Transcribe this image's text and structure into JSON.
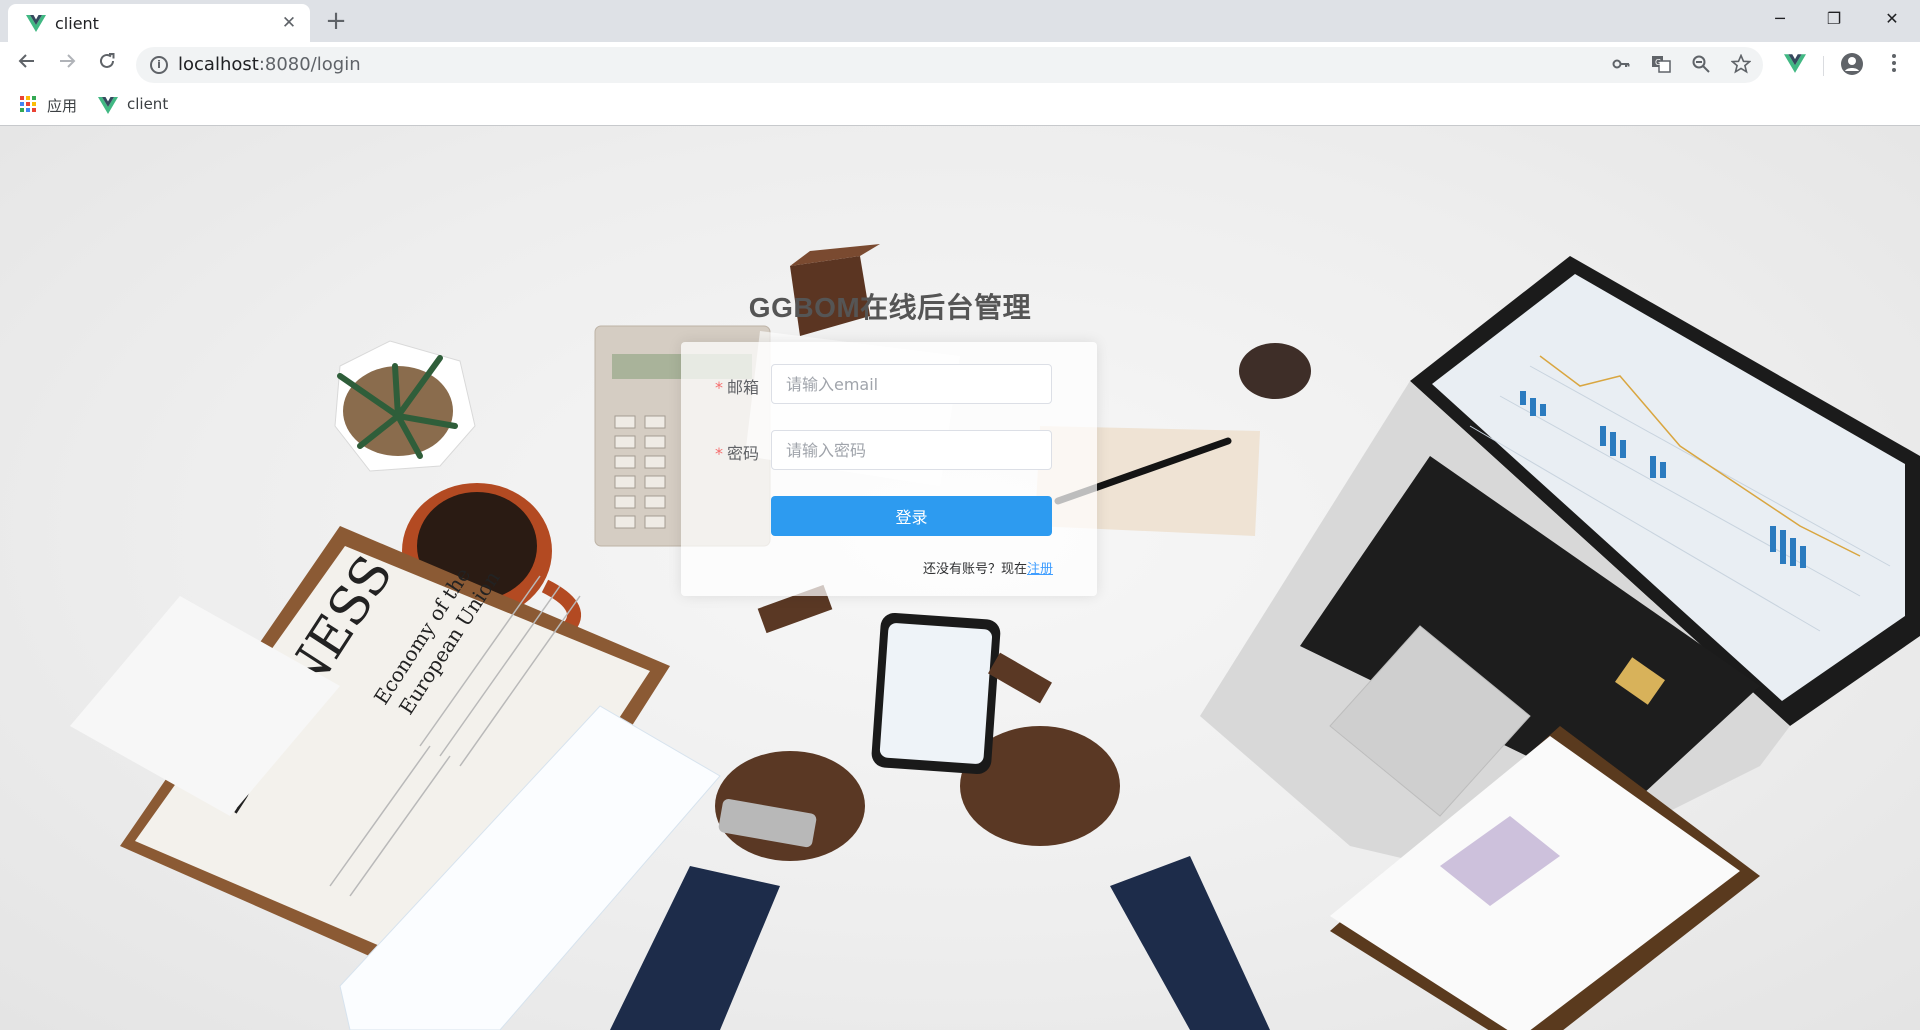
{
  "browser": {
    "tab_title": "client",
    "tab_close": "✕",
    "new_tab": "+",
    "url_host": "localhost",
    "url_path": ":8080/login",
    "window_controls": {
      "minimize": "─",
      "restore": "❐",
      "close": "✕"
    },
    "icons": [
      "back-icon",
      "forward-icon",
      "reload-icon",
      "info-icon",
      "key-icon",
      "translate-icon",
      "zoom-out-icon",
      "star-icon",
      "vue-devtools-icon",
      "account-icon",
      "menu-icon"
    ],
    "bookmarks": {
      "apps_label": "应用",
      "client_label": "client"
    }
  },
  "page": {
    "title": "GGBOM在线后台管理",
    "form": {
      "email_label": "邮箱",
      "email_placeholder": "请输入email",
      "password_label": "密码",
      "password_placeholder": "请输入密码",
      "required_mark": "*",
      "submit_label": "登录",
      "register_prompt": "还没有账号？现在",
      "register_link": "注册"
    }
  },
  "colors": {
    "primary_button": "#2d9bf0",
    "link": "#409eff",
    "required": "#f56c6c",
    "vue_green": "#41b883",
    "vue_dark": "#35495e"
  }
}
